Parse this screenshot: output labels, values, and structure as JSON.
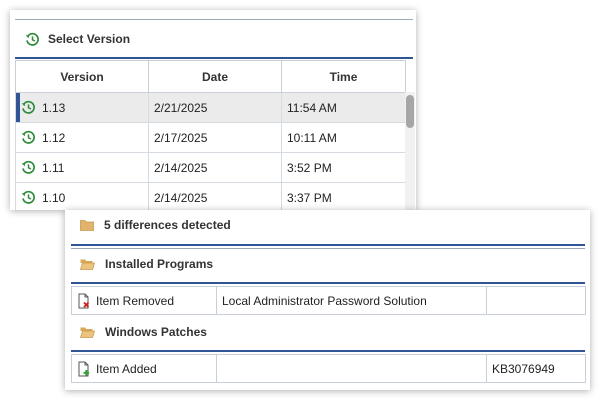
{
  "version_panel": {
    "title": "Select Version",
    "columns": [
      "Version",
      "Date",
      "Time"
    ],
    "rows": [
      {
        "version": "1.13",
        "date": "2/21/2025",
        "time": "11:54 AM",
        "selected": true
      },
      {
        "version": "1.12",
        "date": "2/17/2025",
        "time": "10:11 AM",
        "selected": false
      },
      {
        "version": "1.11",
        "date": "2/14/2025",
        "time": "3:52 PM",
        "selected": false
      },
      {
        "version": "1.10",
        "date": "2/14/2025",
        "time": "3:37 PM",
        "selected": false
      }
    ]
  },
  "diff_panel": {
    "summary": "5 differences detected",
    "groups": [
      {
        "name": "Installed Programs",
        "rows": [
          {
            "status": "Item Removed",
            "status_icon": "file-removed-icon",
            "name": "Local Administrator Password Solution",
            "detail": ""
          }
        ]
      },
      {
        "name": "Windows Patches",
        "rows": [
          {
            "status": "Item Added",
            "status_icon": "file-added-icon",
            "name": "",
            "detail": "KB3076949"
          }
        ]
      }
    ]
  },
  "icons": {
    "version": "history-clock-icon",
    "folder": "folder-icon",
    "open_folder": "open-folder-icon"
  },
  "colors": {
    "accent": "#2f5597",
    "history_icon": "#2e8b3a",
    "folder": "#e0b46c",
    "removed": "#cc2020",
    "added": "#2ea02e",
    "selected_row": "#ebebeb"
  }
}
